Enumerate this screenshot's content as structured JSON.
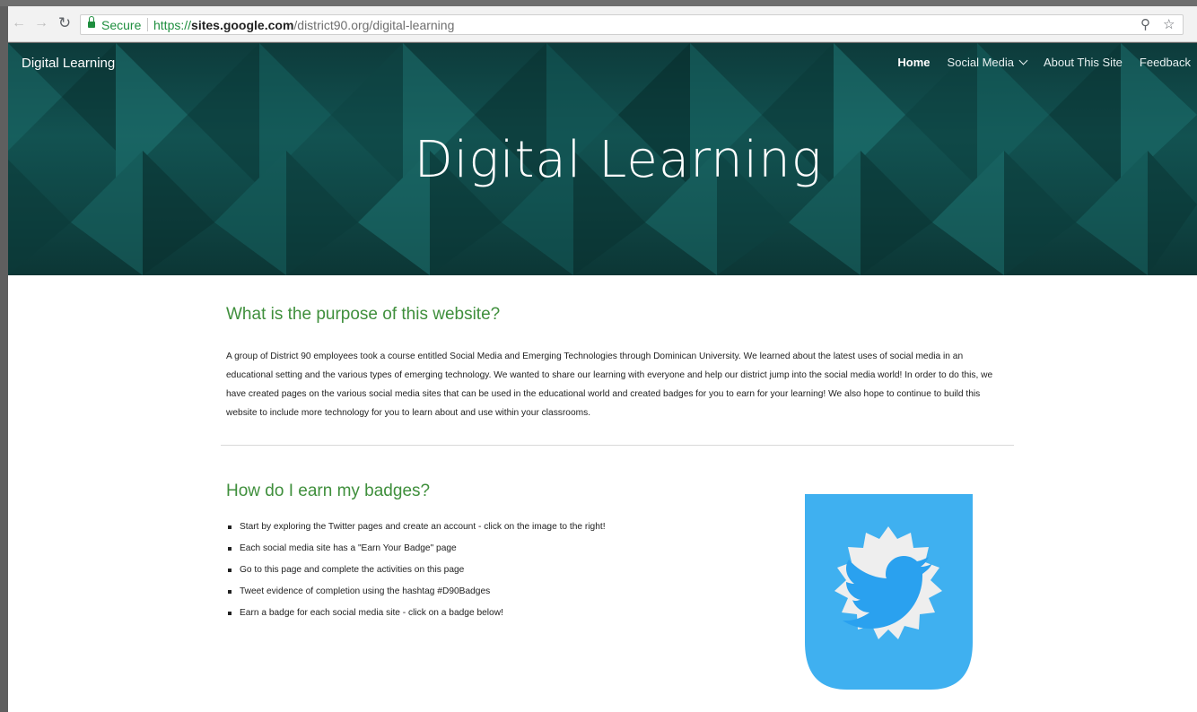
{
  "browser": {
    "secure_label": "Secure",
    "url_scheme": "https://",
    "url_host": "sites.google.com",
    "url_path": "/district90.org/digital-learning",
    "icons": [
      "back-icon",
      "forward-icon",
      "reload-icon",
      "lock-icon",
      "zoom-icon",
      "bookmark-star-icon"
    ]
  },
  "site": {
    "name": "Digital Learning",
    "nav": [
      {
        "label": "Home",
        "active": true
      },
      {
        "label": "Social Media",
        "has_dropdown": true
      },
      {
        "label": "About This Site"
      },
      {
        "label": "Feedback"
      }
    ],
    "hero_title": "Digital Learning"
  },
  "purpose": {
    "heading": "What is the purpose of this website?",
    "body": "A group of District 90 employees took a course entitled Social Media and Emerging Technologies through Dominican University.  We learned about the latest uses of social media in an educational setting and the various types of emerging technology.  We wanted to share our learning with everyone and help our district jump into the social media world!  In order to do this, we have created pages on the various social media sites that can be used in the educational world and created badges for you to earn for your learning!  We also hope to continue to build this website to include more technology for you to learn about and use within your classrooms."
  },
  "badges": {
    "heading": "How do I earn my badges?",
    "steps": [
      "Start by exploring the Twitter pages and create an account  - click on the image to the right!",
      "Each social media site has a \"Earn Your Badge\" page",
      "Go to this page and complete the activities on this page",
      "Tweet evidence of completion using the hashtag #D90Badges",
      "Earn a badge for each social media site - click on a badge below!"
    ],
    "image_icon": "twitter-badge-icon"
  },
  "colors": {
    "heading_green": "#3f8f3c",
    "secure_green": "#1e8e3e",
    "hero_teal": "#125251",
    "badge_blue": "#3fb0f0",
    "badge_grey": "#eeeeee"
  }
}
